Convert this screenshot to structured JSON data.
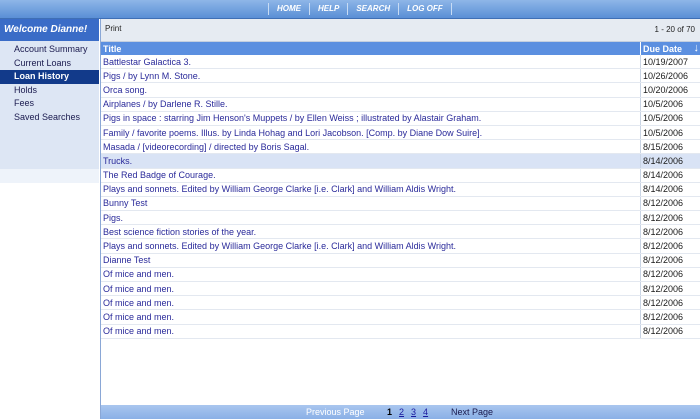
{
  "nav": [
    "HOME",
    "HELP",
    "SEARCH",
    "LOG OFF"
  ],
  "welcome": "Welcome Dianne!",
  "menu": [
    "Account Summary",
    "Current Loans",
    "Loan History",
    "Holds",
    "Fees",
    "Saved Searches"
  ],
  "toolbar": {
    "print": "Print",
    "range": "1 - 20 of 70"
  },
  "table": {
    "headers": {
      "title": "Title",
      "due": "Due Date"
    },
    "rows": [
      {
        "title": "Battlestar Galactica 3.",
        "date": "10/19/2007"
      },
      {
        "title": "Pigs / by Lynn M. Stone.",
        "date": "10/26/2006"
      },
      {
        "title": "Orca song.",
        "date": "10/20/2006"
      },
      {
        "title": "Airplanes / by Darlene R. Stille.",
        "date": "10/5/2006"
      },
      {
        "title": "Pigs in space : starring Jim Henson's Muppets / by Ellen Weiss ; illustrated by Alastair Graham.",
        "date": "10/5/2006"
      },
      {
        "title": "Family / favorite poems. Illus. by Linda Hohag and Lori Jacobson. [Comp. by Diane Dow Suire].",
        "date": "10/5/2006"
      },
      {
        "title": "Masada / [videorecording] / directed by Boris Sagal.",
        "date": "8/15/2006"
      },
      {
        "title": "Trucks.",
        "date": "8/14/2006"
      },
      {
        "title": "The Red Badge of Courage.",
        "date": "8/14/2006"
      },
      {
        "title": "Plays and sonnets. Edited by William George Clarke [i.e. Clark] and William Aldis Wright.",
        "date": "8/14/2006"
      },
      {
        "title": "Bunny Test",
        "date": "8/12/2006"
      },
      {
        "title": "Pigs.",
        "date": "8/12/2006"
      },
      {
        "title": "Best science fiction stories of the year.",
        "date": "8/12/2006"
      },
      {
        "title": "Plays and sonnets. Edited by William George Clarke [i.e. Clark] and William Aldis Wright.",
        "date": "8/12/2006"
      },
      {
        "title": "Dianne Test",
        "date": "8/12/2006"
      },
      {
        "title": "Of mice and men.",
        "date": "8/12/2006"
      },
      {
        "title": "Of mice and men.",
        "date": "8/12/2006"
      },
      {
        "title": "Of mice and men.",
        "date": "8/12/2006"
      },
      {
        "title": "Of mice and men.",
        "date": "8/12/2006"
      },
      {
        "title": "Of mice and men.",
        "date": "8/12/2006"
      }
    ]
  },
  "pager": {
    "prev": "Previous Page",
    "pages": [
      "1",
      "2",
      "3",
      "4"
    ],
    "next": "Next Page"
  }
}
